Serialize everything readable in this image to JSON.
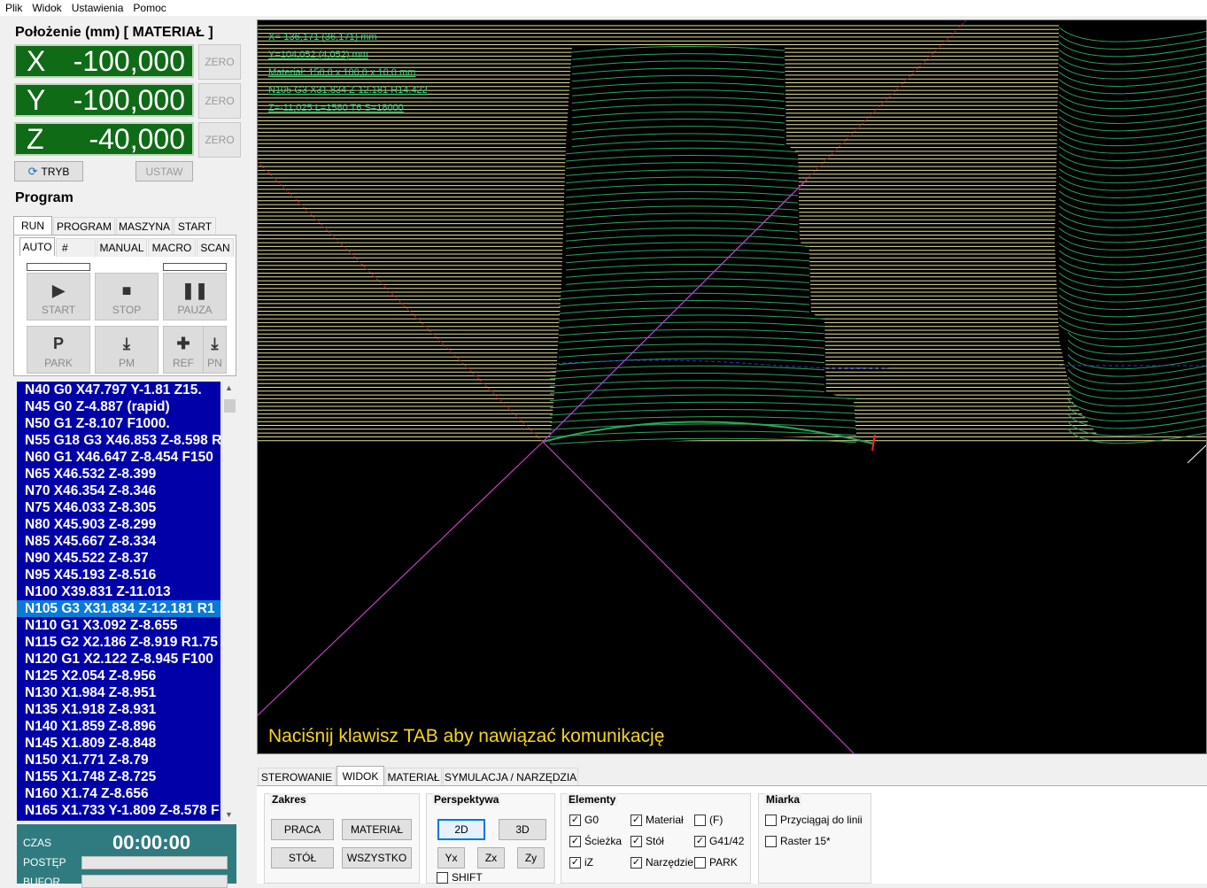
{
  "menu": [
    "Plik",
    "Widok",
    "Ustawienia",
    "Pomoc"
  ],
  "position": {
    "title": "Położenie (mm) [ MATERIAŁ ]",
    "axes": [
      {
        "letter": "X",
        "value": "-100,000"
      },
      {
        "letter": "Y",
        "value": "-100,000"
      },
      {
        "letter": "Z",
        "value": "-40,000"
      }
    ],
    "zero_label": "ZERO",
    "tryb_label": "TRYB",
    "ustaw_label": "USTAW"
  },
  "program": {
    "title": "Program",
    "tabs": [
      "RUN",
      "PROGRAM",
      "MASZYNA",
      "START"
    ],
    "subtabs": [
      "AUTO",
      "#",
      "MANUAL",
      "MACRO",
      "SCAN"
    ],
    "buttons": {
      "start": "START",
      "stop": "STOP",
      "pauza": "PAUZA",
      "park": "PARK",
      "pm": "PM",
      "ref": "REF",
      "pn": "PN"
    },
    "lines": [
      "N40  G0 X47.797 Y-1.81 Z15.",
      "N45  G0 Z-4.887 (rapid)",
      "N50  G1 Z-8.107 F1000.",
      "N55  G18 G3 X46.853 Z-8.598 R",
      "N60  G1 X46.647 Z-8.454 F150",
      "N65  X46.532 Z-8.399",
      "N70  X46.354 Z-8.346",
      "N75  X46.033 Z-8.305",
      "N80  X45.903 Z-8.299",
      "N85  X45.667 Z-8.334",
      "N90  X45.522 Z-8.37",
      "N95  X45.193 Z-8.516",
      "N100  X39.831 Z-11.013",
      "N105  G3 X31.834 Z-12.181 R1",
      "N110  G1 X3.092 Z-8.655",
      "N115  G2 X2.186 Z-8.919 R1.75",
      "N120  G1 X2.122 Z-8.945 F100",
      "N125  X2.054 Z-8.956",
      "N130  X1.984 Z-8.951",
      "N135  X1.918 Z-8.931",
      "N140  X1.859 Z-8.896",
      "N145  X1.809 Z-8.848",
      "N150  X1.771 Z-8.79",
      "N155  X1.748 Z-8.725",
      "N160  X1.74 Z-8.656",
      "N165  X1.733 Y-1.809 Z-8.578 F"
    ],
    "selected_index": 13
  },
  "stats": {
    "czas_label": "CZAS",
    "czas_value": "00:00:00",
    "postep_label": "POSTĘP",
    "bufor_label": "BUFOR"
  },
  "viewport": {
    "hud": [
      "X=-136,171 (36,171) mm",
      "Y=104,052 (4,052) mm",
      "Materiał: 150,0 x 100,0 x 10,0 mm",
      "N105  G3 X31.834 Z-12.181 R14.422",
      "Z=-11,025 L=1580 T6 S=18000"
    ],
    "message": "Naciśnij klawisz TAB aby nawiązać komunikację"
  },
  "bottom": {
    "tabs": [
      "STEROWANIE",
      "WIDOK",
      "MATERIAŁ",
      "SYMULACJA / NARZĘDZIA"
    ],
    "zakres": {
      "title": "Zakres",
      "buttons": [
        "PRACA",
        "MATERIAŁ",
        "STÓŁ",
        "WSZYSTKO"
      ]
    },
    "perspektywa": {
      "title": "Perspektywa",
      "b2d": "2D",
      "b3d": "3D",
      "yx": "Yx",
      "zx": "Zx",
      "zy": "Zy",
      "shift": "SHIFT"
    },
    "elementy": {
      "title": "Elementy",
      "items": [
        {
          "label": "G0",
          "checked": true
        },
        {
          "label": "Materiał",
          "checked": true
        },
        {
          "label": "(F)",
          "checked": false
        },
        {
          "label": "Ścieżka",
          "checked": true
        },
        {
          "label": "Stół",
          "checked": true
        },
        {
          "label": "G41/42",
          "checked": true
        },
        {
          "label": "iZ",
          "checked": true
        },
        {
          "label": "Narzędzie",
          "checked": true
        },
        {
          "label": "PARK",
          "checked": false
        }
      ]
    },
    "miarka": {
      "title": "Miarka",
      "items": [
        {
          "label": "Przyciągaj do linii",
          "checked": false
        },
        {
          "label": "Raster 15*",
          "checked": false
        }
      ]
    }
  },
  "colors": {
    "axis_bg": "#0f6b16",
    "code_bg": "#0000a8",
    "code_sel": "#0a7ad8",
    "hud": "#3bd87e",
    "message": "#f5d620",
    "stats_bg": "#2f7b7f"
  }
}
